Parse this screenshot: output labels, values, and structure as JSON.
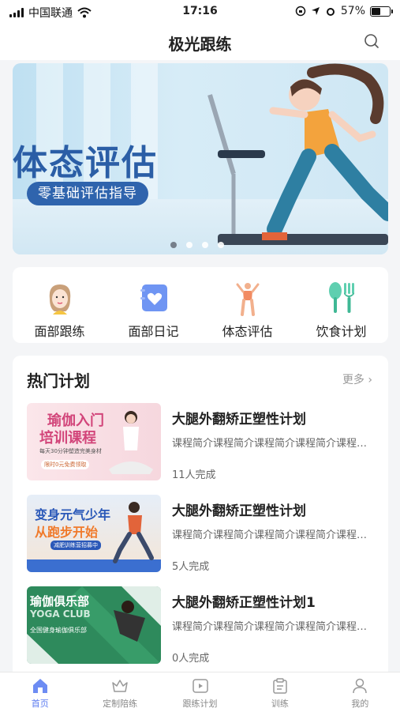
{
  "status_bar": {
    "carrier": "中国联通",
    "time": "17:16",
    "battery": "57%",
    "battery_level": 0.57
  },
  "header": {
    "title": "极光跟练"
  },
  "banner": {
    "title": "体态评估",
    "subtitle": "零基础评估指导",
    "page_count": 4,
    "active_page": 1
  },
  "categories": [
    {
      "label": "面部跟练",
      "icon": "face-woman-icon"
    },
    {
      "label": "面部日记",
      "icon": "heart-diary-icon"
    },
    {
      "label": "体态评估",
      "icon": "posture-figure-icon"
    },
    {
      "label": "饮食计划",
      "icon": "spoon-fork-icon"
    }
  ],
  "hot_plans": {
    "title": "热门计划",
    "more": "更多",
    "items": [
      {
        "title": "大腿外翻矫正塑性计划",
        "desc": "课程简介课程简介课程简介课程简介课程简介",
        "completed": "11人完成",
        "thumb": {
          "headline": "瑜伽入门",
          "headline2": "培训课程",
          "note": "每天30分钟塑造完美身材",
          "tag": "限时0元免费领取"
        }
      },
      {
        "title": "大腿外翻矫正塑性计划",
        "desc": "课程简介课程简介课程简介课程简介课程简介",
        "completed": "5人完成",
        "thumb": {
          "headline": "变身元气少年",
          "headline2": "从跑步开始",
          "note": "减肥训练营招募中"
        }
      },
      {
        "title": "大腿外翻矫正塑性计划1",
        "desc": "课程简介课程简介课程简介课程简介课程简介",
        "completed": "0人完成",
        "thumb": {
          "headline": "瑜伽俱乐部",
          "headline2": "YOGA CLUB",
          "note": "全国健身瑜伽俱乐部"
        }
      }
    ]
  },
  "tabbar": [
    {
      "label": "首页",
      "icon": "home-icon",
      "active": true
    },
    {
      "label": "定制陪练",
      "icon": "crown-icon",
      "active": false
    },
    {
      "label": "跟练计划",
      "icon": "play-video-icon",
      "active": false
    },
    {
      "label": "训练",
      "icon": "clipboard-icon",
      "active": false
    },
    {
      "label": "我的",
      "icon": "user-icon",
      "active": false
    }
  ],
  "colors": {
    "accent": "#5b7bf0",
    "banner_blue": "#2f64ad"
  }
}
